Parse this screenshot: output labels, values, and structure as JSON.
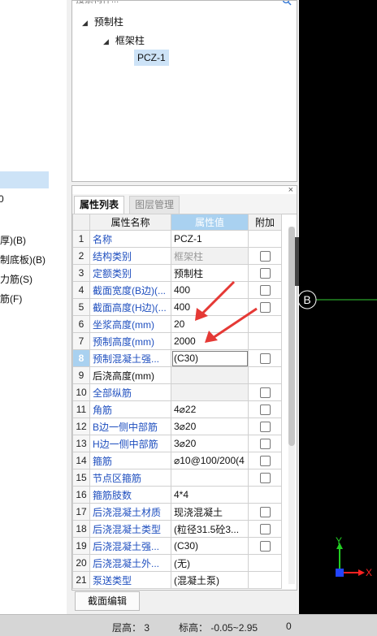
{
  "search": {
    "placeholder": "搜索构件..."
  },
  "left_items": [
    "厚)(B)",
    "制底板)(B)",
    "力筋(S)",
    "筋(F)"
  ],
  "left_stub": "0",
  "tree": {
    "root": "预制柱",
    "child": "框架柱",
    "leaf": "PCZ-1"
  },
  "panel": {
    "close": "×"
  },
  "tabs": {
    "active": "属性列表",
    "inactive": "图层管理"
  },
  "table": {
    "headers": {
      "name": "属性名称",
      "value": "属性值",
      "extra": "附加"
    },
    "rows": [
      {
        "num": "1",
        "name": "名称",
        "value": "PCZ-1",
        "name_style": "blue",
        "value_style": "",
        "check": false
      },
      {
        "num": "2",
        "name": "结构类别",
        "value": "框架柱",
        "name_style": "blue",
        "value_style": "gray",
        "check": true
      },
      {
        "num": "3",
        "name": "定额类别",
        "value": "预制柱",
        "name_style": "blue",
        "value_style": "",
        "check": true
      },
      {
        "num": "4",
        "name": "截面宽度(B边)(...",
        "value": "400",
        "name_style": "blue",
        "value_style": "",
        "check": true
      },
      {
        "num": "5",
        "name": "截面高度(H边)(...",
        "value": "400",
        "name_style": "blue",
        "value_style": "",
        "check": true
      },
      {
        "num": "6",
        "name": "坐浆高度(mm)",
        "value": "20",
        "name_style": "blue",
        "value_style": "",
        "check": false
      },
      {
        "num": "7",
        "name": "预制高度(mm)",
        "value": "2000",
        "name_style": "blue",
        "value_style": "",
        "check": false
      },
      {
        "num": "8",
        "name": "预制混凝土强...",
        "value": "(C30)",
        "name_style": "blue",
        "value_style": "edit",
        "check": true
      },
      {
        "num": "9",
        "name": "后浇高度(mm)",
        "value": "",
        "name_style": "black",
        "value_style": "gray",
        "check": false
      },
      {
        "num": "10",
        "name": "全部纵筋",
        "value": "",
        "name_style": "blue",
        "value_style": "gray",
        "check": true
      },
      {
        "num": "11",
        "name": "角筋",
        "value": "4⌀22",
        "name_style": "blue",
        "value_style": "",
        "check": true
      },
      {
        "num": "12",
        "name": "B边一侧中部筋",
        "value": "3⌀20",
        "name_style": "blue",
        "value_style": "",
        "check": true
      },
      {
        "num": "13",
        "name": "H边一侧中部筋",
        "value": "3⌀20",
        "name_style": "blue",
        "value_style": "",
        "check": true
      },
      {
        "num": "14",
        "name": "箍筋",
        "value": "⌀10@100/200(4",
        "name_style": "blue",
        "value_style": "",
        "check": true
      },
      {
        "num": "15",
        "name": "节点区箍筋",
        "value": "",
        "name_style": "blue",
        "value_style": "",
        "check": true
      },
      {
        "num": "16",
        "name": "箍筋肢数",
        "value": "4*4",
        "name_style": "blue",
        "value_style": "",
        "check": false
      },
      {
        "num": "17",
        "name": "后浇混凝土材质",
        "value": "现浇混凝土",
        "name_style": "blue",
        "value_style": "",
        "check": true
      },
      {
        "num": "18",
        "name": "后浇混凝土类型",
        "value": "(粒径31.5砼3...",
        "name_style": "blue",
        "value_style": "",
        "check": true
      },
      {
        "num": "19",
        "name": "后浇混凝土强...",
        "value": "(C30)",
        "name_style": "blue",
        "value_style": "",
        "check": true
      },
      {
        "num": "20",
        "name": "后浇混凝土外...",
        "value": "(无)",
        "name_style": "blue",
        "value_style": "",
        "check": false
      },
      {
        "num": "21",
        "name": "泵送类型",
        "value": "(混凝土泵)",
        "name_style": "blue",
        "value_style": "",
        "check": false
      }
    ]
  },
  "section_button": "截面编辑",
  "canvas": {
    "axis_label": "B",
    "axis_x": "X",
    "axis_y": "Y"
  },
  "status": {
    "floor_height": "层高：  3",
    "elevation": "标高：  -0.05~2.95",
    "extra": "0"
  },
  "colors": {
    "selection": "#cde3f7",
    "header_highlight": "#a9d1f0",
    "arrow": "#e53935",
    "axis_line": "#33cc33",
    "axis_x": "#ff2222",
    "axis_y": "#22cc22",
    "label_blue": "#1f4fbf"
  }
}
